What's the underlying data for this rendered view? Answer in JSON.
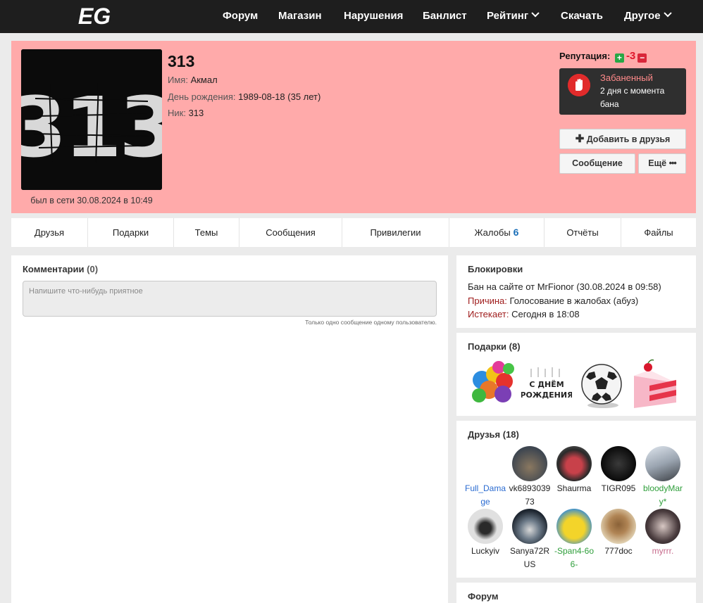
{
  "nav": {
    "logo_text": "EG",
    "items": [
      {
        "label": "Форум"
      },
      {
        "label": "Магазин"
      },
      {
        "label": "Нарушения"
      },
      {
        "label": "Банлист"
      },
      {
        "label": "Рейтинг"
      },
      {
        "label": "Скачать"
      },
      {
        "label": "Другое"
      }
    ]
  },
  "profile": {
    "avatar_text": "313",
    "name": "313",
    "first_name_label": "Имя:",
    "first_name": "Акмал",
    "birthday_label": "День рождения:",
    "birthday": "1989-08-18 (35 лет)",
    "nick_label": "Ник:",
    "nick": "313",
    "last_seen": "был в сети 30.08.2024 в 10:49",
    "reputation_label": "Репутация:",
    "reputation_value": "-3",
    "ban_title": "Забаненный",
    "ban_text": "2 дня с момента бана",
    "add_friend_label": "Добавить в друзья",
    "message_label": "Сообщение",
    "more_label": "Ещё",
    "bg_color": "#ffaaaa"
  },
  "tabs": [
    {
      "label": "Друзья",
      "count": ""
    },
    {
      "label": "Подарки",
      "count": ""
    },
    {
      "label": "Темы",
      "count": ""
    },
    {
      "label": "Сообщения",
      "count": ""
    },
    {
      "label": "Привилегии",
      "count": ""
    },
    {
      "label": "Жалобы",
      "count": "6"
    },
    {
      "label": "Отчёты",
      "count": ""
    },
    {
      "label": "Файлы",
      "count": ""
    }
  ],
  "comments": {
    "title": "Комментарии",
    "count": "(0)",
    "placeholder": "Напишите что-нибудь приятное",
    "hint": "Только одно сообщение одному пользователю."
  },
  "blocks": {
    "title": "Блокировки",
    "line1": "Бан на сайте от MrFionor (30.08.2024 в 09:58)",
    "reason_label": "Причина:",
    "reason": "Голосование в жалобах (абуз)",
    "expires_label": "Истекает:",
    "expires": "Сегодня в 18:08"
  },
  "gifts": {
    "title": "Подарки (8)",
    "birthday_card_line1": "С ДНЁМ",
    "birthday_card_line2": "РОЖДЕНИЯ",
    "items": [
      "balloons-gift",
      "birthday-card-gift",
      "soccer-ball-gift",
      "cake-gift"
    ]
  },
  "friends": {
    "title": "Друзья (18)",
    "items": [
      {
        "name": "Full_Damage",
        "color": "#2a6bd1"
      },
      {
        "name": "vk689303973",
        "color": "#222222"
      },
      {
        "name": "Shaurma",
        "color": "#222222"
      },
      {
        "name": "TIGR095",
        "color": "#222222"
      },
      {
        "name": "bloodyMary*",
        "color": "#2e9e3a"
      },
      {
        "name": "Luckyiv",
        "color": "#222222"
      },
      {
        "name": "Sanya72RUS",
        "color": "#222222"
      },
      {
        "name": "-Span4-6o6-",
        "color": "#2e9e3a"
      },
      {
        "name": "777doc",
        "color": "#222222"
      },
      {
        "name": "myrrr.",
        "color": "#c76b8c"
      }
    ]
  },
  "forum": {
    "title": "Форум"
  }
}
